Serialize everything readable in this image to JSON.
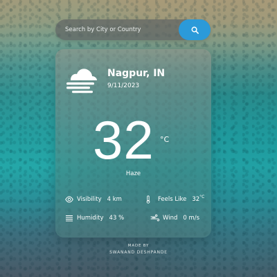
{
  "search": {
    "placeholder": "Search by City or Country",
    "value": "",
    "button_icon": "search-icon",
    "button_color": "#2b9ad9"
  },
  "weather": {
    "icon": "haze-cloud-icon",
    "city": "Nagpur, IN",
    "date": "9/11/2023",
    "temperature": "32",
    "temperature_unit": "°C",
    "condition": "Haze"
  },
  "stats": {
    "visibility": {
      "icon": "eye-icon",
      "label": "Visibility",
      "value": "4 km"
    },
    "feels_like": {
      "icon": "thermometer-icon",
      "label": "Feels Like",
      "value": "32",
      "unit": "°C"
    },
    "humidity": {
      "icon": "humidity-lines-icon",
      "label": "Humidity",
      "value": "43 %"
    },
    "wind": {
      "icon": "wind-icon",
      "label": "Wind",
      "value": "0 m/s"
    }
  },
  "credit": {
    "line1": "MADE BY",
    "line2": "SWANAND DESHPANDE"
  }
}
